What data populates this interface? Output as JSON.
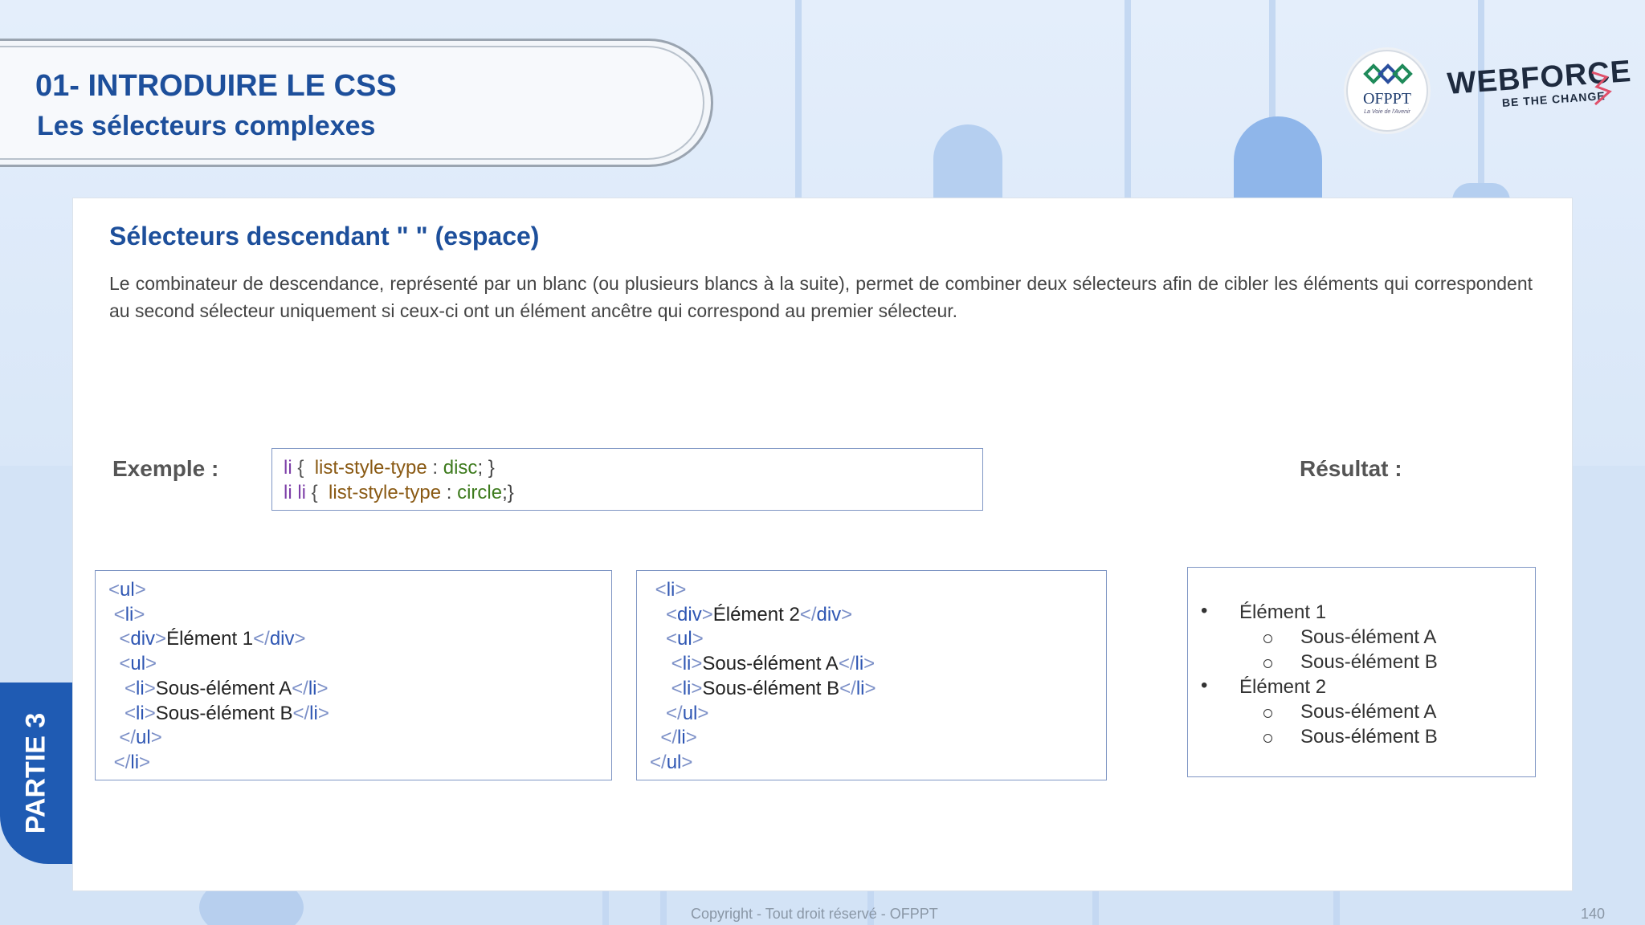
{
  "header": {
    "title": "01- INTRODUIRE LE CSS",
    "subtitle": "Les sélecteurs complexes"
  },
  "logos": {
    "ofppt": "OFPPT",
    "ofppt_tagline": "La Voie de l'Avenir",
    "webforce": "WEBFORCE",
    "webforce_tagline": "BE THE CHANGE"
  },
  "section": {
    "title": "Sélecteurs descendant \" \" (espace)",
    "description": "Le combinateur de descendance, représenté par un blanc (ou plusieurs blancs à la suite), permet de combiner deux sélecteurs afin de cibler les éléments qui correspondent au second sélecteur uniquement si ceux-ci ont un élément ancêtre qui correspond au premier sélecteur."
  },
  "labels": {
    "exemple": "Exemple :",
    "resultat": "Résultat :"
  },
  "css_rules": [
    {
      "selector": "li",
      "property": "list-style-type",
      "value": "disc",
      "end": "; }"
    },
    {
      "selector": "li li",
      "property": "list-style-type",
      "value": "circle",
      "end": ";}"
    }
  ],
  "html_code_1": [
    {
      "indent": "",
      "open": "<",
      "tag": "ul",
      "close": ">",
      "text": "",
      "etag": ""
    },
    {
      "indent": " ",
      "open": "<",
      "tag": "li",
      "close": ">",
      "text": "",
      "etag": ""
    },
    {
      "indent": "  ",
      "open": "<",
      "tag": "div",
      "close": ">",
      "text": "Élément 1",
      "etag": "</div>"
    },
    {
      "indent": "  ",
      "open": "<",
      "tag": "ul",
      "close": ">",
      "text": "",
      "etag": ""
    },
    {
      "indent": "   ",
      "open": "<",
      "tag": "li",
      "close": ">",
      "text": "Sous-élément A",
      "etag": "</li>"
    },
    {
      "indent": "   ",
      "open": "<",
      "tag": "li",
      "close": ">",
      "text": "Sous-élément B",
      "etag": "</li>"
    },
    {
      "indent": "  ",
      "open": "</",
      "tag": "ul",
      "close": ">",
      "text": "",
      "etag": ""
    },
    {
      "indent": " ",
      "open": "</",
      "tag": "li",
      "close": ">",
      "text": "",
      "etag": ""
    }
  ],
  "html_code_2": [
    {
      "indent": " ",
      "open": "<",
      "tag": "li",
      "close": ">",
      "text": "",
      "etag": ""
    },
    {
      "indent": "   ",
      "open": "<",
      "tag": "div",
      "close": ">",
      "text": "Élément 2",
      "etag": "</div>"
    },
    {
      "indent": "   ",
      "open": "<",
      "tag": "ul",
      "close": ">",
      "text": "",
      "etag": ""
    },
    {
      "indent": "    ",
      "open": "<",
      "tag": "li",
      "close": ">",
      "text": "Sous-élément A",
      "etag": "</li>"
    },
    {
      "indent": "    ",
      "open": "<",
      "tag": "li",
      "close": ">",
      "text": "Sous-élément B",
      "etag": "</li>"
    },
    {
      "indent": "   ",
      "open": "</",
      "tag": "ul",
      "close": ">",
      "text": "",
      "etag": ""
    },
    {
      "indent": "  ",
      "open": "</",
      "tag": "li",
      "close": ">",
      "text": "",
      "etag": ""
    },
    {
      "indent": "",
      "open": "</",
      "tag": "ul",
      "close": ">",
      "text": "",
      "etag": ""
    }
  ],
  "result": {
    "items": [
      {
        "label": "Élément 1",
        "children": [
          "Sous-élément A",
          "Sous-élément B"
        ]
      },
      {
        "label": "Élément 2",
        "children": [
          "Sous-élément A",
          "Sous-élément B"
        ]
      }
    ]
  },
  "sidebar_tab": "PARTIE 3",
  "footer": {
    "copyright": "Copyright - Tout droit réservé - OFPPT",
    "page_number": "140"
  },
  "colors": {
    "brand_blue": "#1d4f9b",
    "tab_blue": "#1f5bb3",
    "code_tag": "#2e56b3",
    "code_bracket": "#7b8fc7",
    "css_selector": "#7d3fa8",
    "css_property": "#8a5a14",
    "css_value": "#3e7b1e"
  }
}
